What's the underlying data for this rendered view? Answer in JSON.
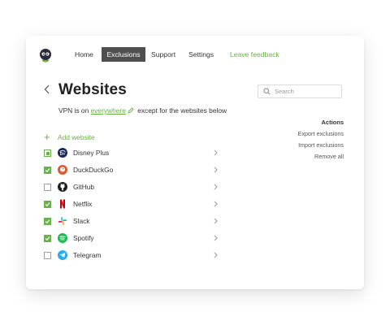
{
  "nav": {
    "items": [
      {
        "label": "Home"
      },
      {
        "label": "Exclusions",
        "active": true
      },
      {
        "label": "Support"
      },
      {
        "label": "Settings"
      },
      {
        "label": "Leave feedback"
      }
    ]
  },
  "page": {
    "title": "Websites",
    "search_placeholder": "Search"
  },
  "status": {
    "prefix": "VPN is on",
    "mode": "everywhere",
    "suffix": "except for the websites below"
  },
  "actions": {
    "title": "Actions",
    "items": [
      "Export exclusions",
      "Import exclusions",
      "Remove all"
    ]
  },
  "add_website_label": "Add website",
  "sites": [
    {
      "name": "Disney Plus",
      "state": "partial",
      "icon": "disney-plus-icon"
    },
    {
      "name": "DuckDuckGo",
      "state": "checked",
      "icon": "duckduckgo-icon"
    },
    {
      "name": "GitHub",
      "state": "unchecked",
      "icon": "github-icon"
    },
    {
      "name": "Netflix",
      "state": "checked",
      "icon": "netflix-icon"
    },
    {
      "name": "Slack",
      "state": "checked",
      "icon": "slack-icon"
    },
    {
      "name": "Spotify",
      "state": "checked",
      "icon": "spotify-icon"
    },
    {
      "name": "Telegram",
      "state": "unchecked",
      "icon": "telegram-icon"
    }
  ],
  "colors": {
    "accent": "#67b243",
    "checkbox": "#6ab04c",
    "active_tab": "#4f4f4f"
  }
}
